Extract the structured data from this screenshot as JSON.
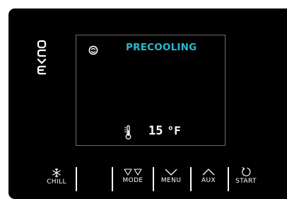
{
  "display": {
    "status_text": "PRECOOLING",
    "temperature_value": "15",
    "temperature_unit": "°F"
  },
  "brand": {
    "logo_text": "evco"
  },
  "buttons": {
    "chill": "CHILL",
    "mode": "MODE",
    "menu": "MENU",
    "aux": "AUX",
    "start": "START"
  },
  "icons": {
    "status_icon": "compressor-icon",
    "temperature_icon": "thermometer-icon",
    "chill_icon": "snowflake-icon",
    "mode_icon": "double-down-triangle-icon",
    "menu_icon": "chevron-down-icon",
    "aux_icon": "chevron-up-icon",
    "start_icon": "refresh-icon"
  },
  "colors": {
    "accent": "#2ab8cf",
    "panel": "#000000",
    "text": "#ffffff"
  }
}
